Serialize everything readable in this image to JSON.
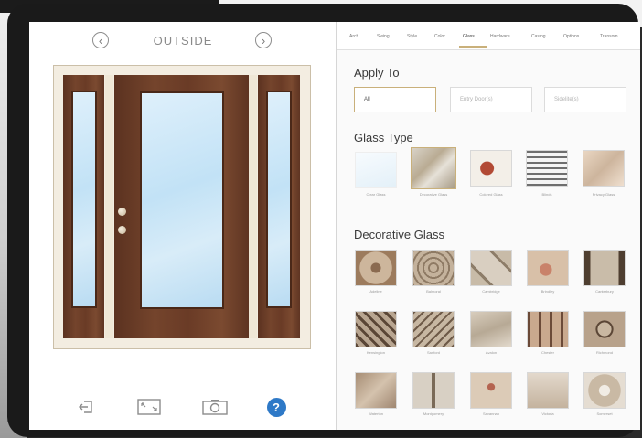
{
  "view": {
    "title": "OUTSIDE",
    "prev_icon": "chevron-left-icon",
    "next_icon": "chevron-right-icon"
  },
  "toolbar": {
    "icons": [
      "exit-icon",
      "fullscreen-icon",
      "camera-icon",
      "help-icon"
    ],
    "help_label": "?"
  },
  "tabs": [
    "Arch",
    "Swing",
    "Style",
    "Color",
    "Glass",
    "Hardware",
    "Casing",
    "Options",
    "Transom"
  ],
  "active_tab": 4,
  "apply_to": {
    "title": "Apply To",
    "options": [
      "All",
      "Entry Door(s)",
      "Sidelite(s)"
    ],
    "selected": 0
  },
  "glass_type": {
    "title": "Glass Type",
    "items": [
      "Clear Glass",
      "Decorative Glass",
      "Colored Glass",
      "Blinds",
      "Privacy Glass"
    ],
    "selected": 1
  },
  "decorative_glass": {
    "title": "Decorative Glass",
    "rows": [
      [
        "Adeline",
        "Balmoral",
        "Cambridge",
        "Brindley",
        "Canterbury"
      ],
      [
        "Kensington",
        "Sanford",
        "Avalon",
        "Chester",
        "Richmond"
      ],
      [
        "Waterton",
        "Montgomery",
        "Savannah",
        "Victoria",
        "Somerset"
      ]
    ]
  },
  "colors": {
    "accent": "#c9b07a",
    "help": "#2e79c7",
    "wood": "#6a3b26",
    "glass": "#c8e4f6"
  }
}
